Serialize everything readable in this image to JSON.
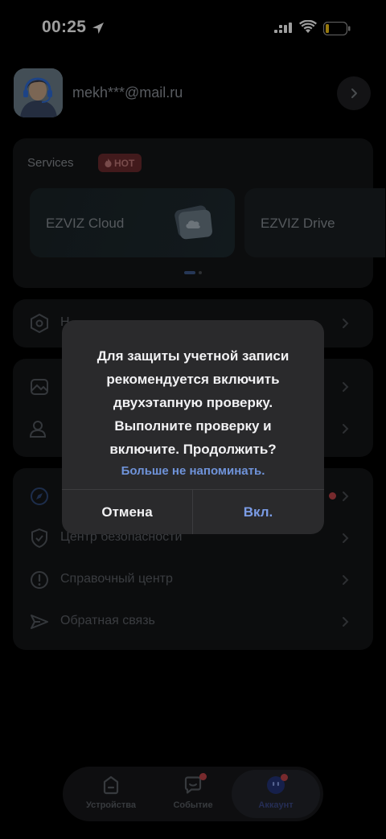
{
  "status_bar": {
    "time": "00:25",
    "icons": [
      "location-arrow-icon",
      "cellular-signal-icon",
      "wifi-icon",
      "battery-icon"
    ]
  },
  "profile": {
    "email": "mekh***@mail.ru",
    "avatar_icon": "user-avatar-icon",
    "arrow_icon": "chevron-right-icon"
  },
  "services": {
    "title": "Services",
    "hot_badge": "HOT",
    "tiles": [
      {
        "label": "EZVIZ Cloud",
        "icon": "cloud-folder-icon"
      },
      {
        "label": "EZVIZ Drive"
      }
    ],
    "pager": {
      "pages": 2,
      "active": 0
    }
  },
  "menu": {
    "group1": [
      {
        "label": "Н",
        "icon": "hexagon-settings-icon"
      }
    ],
    "group2": [
      {
        "label": "",
        "icon": "image-icon"
      },
      {
        "label": "",
        "icon": "users-icon"
      }
    ],
    "group3": [
      {
        "label": "",
        "icon": "compass-icon",
        "has_dot": true
      },
      {
        "label": "Центр безопасности",
        "icon": "shield-check-icon"
      },
      {
        "label": "Справочный центр",
        "icon": "info-circle-icon"
      },
      {
        "label": "Обратная связь",
        "icon": "send-icon"
      }
    ]
  },
  "tab_bar": {
    "tabs": [
      {
        "label": "Устройства",
        "icon": "home-device-icon",
        "badge": false
      },
      {
        "label": "Событие",
        "icon": "chat-event-icon",
        "badge": true
      },
      {
        "label": "Аккаунт",
        "icon": "account-face-icon",
        "badge": true,
        "active": true
      }
    ]
  },
  "dialog": {
    "message": "Для защиты учетной записи рекомендуется включить двухэтапную проверку. Выполните проверку и включите. Продолжить?",
    "link": "Больше не напоминать.",
    "cancel": "Отмена",
    "confirm": "Вкл."
  },
  "colors": {
    "background": "#000000",
    "card": "#141517",
    "dialog": "#2a2a2c",
    "accent_blue": "#7b9ce6",
    "badge_red": "#c0444a"
  }
}
